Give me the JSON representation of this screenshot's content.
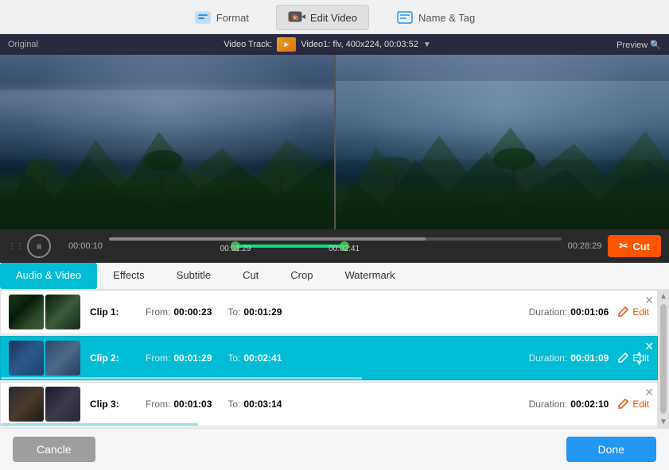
{
  "nav": {
    "tabs": [
      {
        "id": "format",
        "label": "Format",
        "active": false
      },
      {
        "id": "edit-video",
        "label": "Edit Video",
        "active": true
      },
      {
        "id": "name-tag",
        "label": "Name & Tag",
        "active": false
      }
    ]
  },
  "video": {
    "original_label": "Original",
    "video_track_label": "Video Track:",
    "video_info": "Video1: flv, 400x224, 00:03:52",
    "preview_label": "Preview 🔍"
  },
  "timeline": {
    "time_start": "00:00:10",
    "time_end": "00:28:29",
    "handle1_time": "00:01:29",
    "handle2_time": "00:02:41",
    "handle1_pct": 28,
    "handle2_pct": 52,
    "cut_label": "Cut",
    "plus_cut_symbol": "✂"
  },
  "tabs": [
    {
      "id": "audio-video",
      "label": "Audio & Video",
      "active": true
    },
    {
      "id": "effects",
      "label": "Effects",
      "active": false
    },
    {
      "id": "subtitle",
      "label": "Subtitle",
      "active": false
    },
    {
      "id": "cut",
      "label": "Cut",
      "active": false
    },
    {
      "id": "crop",
      "label": "Crop",
      "active": false
    },
    {
      "id": "watermark",
      "label": "Watermark",
      "active": false
    }
  ],
  "clips": [
    {
      "id": 1,
      "name": "Clip 1:",
      "from_label": "From:",
      "from_value": "00:00:23",
      "to_label": "To:",
      "to_value": "00:01:29",
      "duration_label": "Duration:",
      "duration_value": "00:01:06",
      "edit_label": "Edit",
      "selected": false,
      "progress_pct": 0
    },
    {
      "id": 2,
      "name": "Clip 2:",
      "from_label": "From:",
      "from_value": "00:01:29",
      "to_label": "To:",
      "to_value": "00:02:41",
      "duration_label": "Duration:",
      "duration_value": "00:01:09",
      "edit_label": "Edit",
      "selected": true,
      "progress_pct": 55
    },
    {
      "id": 3,
      "name": "Clip 3:",
      "from_label": "From:",
      "from_value": "00:01:03",
      "to_label": "To:",
      "to_value": "00:03:14",
      "duration_label": "Duration:",
      "duration_value": "00:02:10",
      "edit_label": "Edit",
      "selected": false,
      "progress_pct": 30
    }
  ],
  "bottom": {
    "cancel_label": "Cancle",
    "done_label": "Done"
  }
}
